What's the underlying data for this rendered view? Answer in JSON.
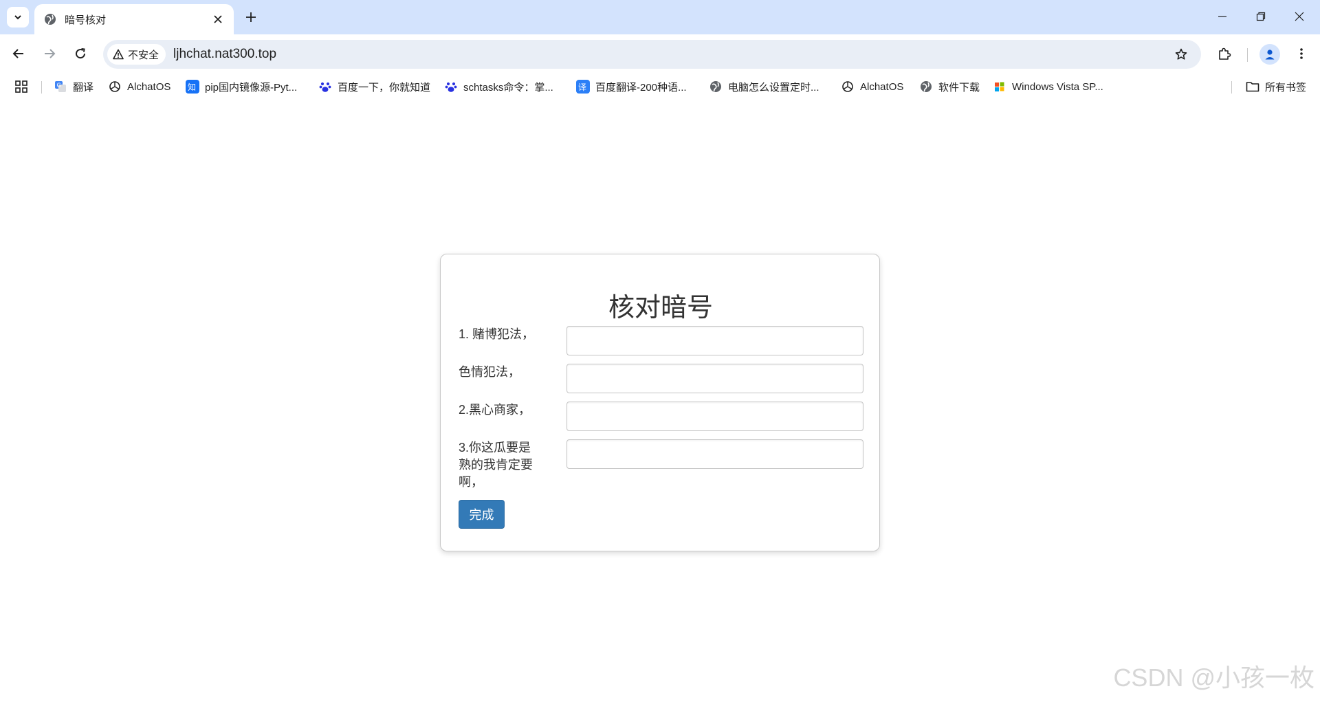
{
  "browser": {
    "tab": {
      "title": "暗号核对"
    },
    "address_bar": {
      "security_label": "不安全",
      "url": "ljhchat.nat300.top"
    },
    "bookmarks": [
      {
        "label": "翻译",
        "icon": "google-translate-icon"
      },
      {
        "label": "AlchatOS",
        "icon": "openai-icon"
      },
      {
        "label": "pip国内镜像源-Pyt...",
        "icon": "zhihu-icon"
      },
      {
        "label": "百度一下，你就知道",
        "icon": "baidu-paw-icon"
      },
      {
        "label": "schtasks命令：掌...",
        "icon": "baidu-paw-icon"
      },
      {
        "label": "百度翻译-200种语...",
        "icon": "baidu-translate-icon"
      },
      {
        "label": "电脑怎么设置定时...",
        "icon": "globe-icon"
      },
      {
        "label": "AlchatOS",
        "icon": "openai-icon"
      },
      {
        "label": "软件下载",
        "icon": "globe-icon"
      },
      {
        "label": "Windows Vista SP...",
        "icon": "windows-icon"
      }
    ],
    "all_bookmarks": "所有书签"
  },
  "form": {
    "title": "核对暗号",
    "fields": [
      {
        "label": "1. 赌博犯法，",
        "value": ""
      },
      {
        "label": "色情犯法，",
        "value": ""
      },
      {
        "label": "2.黑心商家，",
        "value": ""
      },
      {
        "label": "3.你这瓜要是熟的我肯定要啊，",
        "value": ""
      }
    ],
    "submit_label": "完成"
  },
  "watermark": "CSDN @小孩一枚",
  "colors": {
    "tabstrip": "#d3e3fd",
    "omnibox": "#e9eef6",
    "primary_button": "#337ab7"
  }
}
